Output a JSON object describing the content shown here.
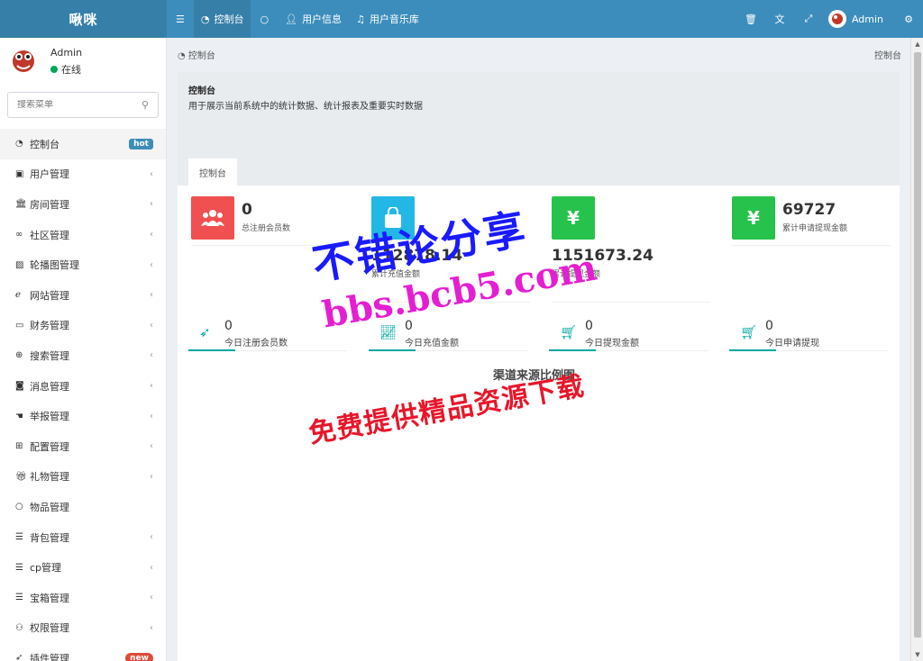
{
  "app": {
    "logo_text": "啾咪",
    "top_nav": [
      {
        "icon": "menu-toggle-icon",
        "label": ""
      },
      {
        "icon": "dashboard-icon",
        "label": "控制台"
      },
      {
        "icon": "circle-icon",
        "label": ""
      },
      {
        "icon": "user-icon",
        "label": "用户信息"
      },
      {
        "icon": "music-icon",
        "label": "用户音乐库"
      }
    ],
    "top_user_name": "Admin"
  },
  "sidebar": {
    "user_name": "Admin",
    "user_status": "在线",
    "search_placeholder": "搜索菜单",
    "items": [
      {
        "label": "控制台",
        "badge": "hot",
        "icon": "dashboard-icon"
      },
      {
        "label": "用户管理",
        "icon": "user-book-icon"
      },
      {
        "label": "房间管理",
        "icon": "bank-icon"
      },
      {
        "label": "社区管理",
        "icon": "bicycle-icon"
      },
      {
        "label": "轮播图管理",
        "icon": "image-icon"
      },
      {
        "label": "网站管理",
        "icon": "ie-icon"
      },
      {
        "label": "财务管理",
        "icon": "money-icon"
      },
      {
        "label": "搜索管理",
        "icon": "search-plus-icon"
      },
      {
        "label": "消息管理",
        "icon": "message-icon"
      },
      {
        "label": "举报管理",
        "icon": "hand-icon"
      },
      {
        "label": "配置管理",
        "icon": "sitemap-icon"
      },
      {
        "label": "礼物管理",
        "icon": "gift-icon"
      },
      {
        "label": "物品管理",
        "icon": "circle-icon"
      },
      {
        "label": "背包管理",
        "icon": "list-icon"
      },
      {
        "label": "cp管理",
        "icon": "list-icon"
      },
      {
        "label": "宝箱管理",
        "icon": "list-icon"
      },
      {
        "label": "权限管理",
        "icon": "group-icon"
      },
      {
        "label": "插件管理",
        "badge": "new",
        "icon": "rocket-icon"
      }
    ]
  },
  "breadcrumb": {
    "left": "控制台",
    "right": "控制台"
  },
  "panel": {
    "title": "控制台",
    "description": "用于展示当前系统中的统计数据、统计报表及重要实时数据",
    "tab": "控制台"
  },
  "stats": [
    {
      "value": "0",
      "label": "总注册会员数",
      "color": "#f05050",
      "icon": "users-icon"
    },
    {
      "value": "112878.14",
      "label": "累计充值金额",
      "color": "#23b7e5",
      "icon": "shopping-bag-icon"
    },
    {
      "value": "1151673.24",
      "label": "累计提现金额",
      "color": "#27c24c",
      "icon": "yen-icon"
    },
    {
      "value": "69727",
      "label": "累计申请提现金额",
      "color": "#27c24c",
      "icon": "yen-icon"
    }
  ],
  "today_stats": [
    {
      "value": "0",
      "label": "今日注册会员数",
      "icon": "rocket-icon"
    },
    {
      "value": "0",
      "label": "今日充值金额",
      "icon": "line-chart-icon"
    },
    {
      "value": "0",
      "label": "今日提现金额",
      "icon": "cart-icon"
    },
    {
      "value": "0",
      "label": "今日申请提现",
      "icon": "cart-icon"
    }
  ],
  "chart_title": "渠道来源比例图",
  "watermark": {
    "line1": "不错论分享",
    "line2": "bbs.bcb5.com",
    "line3": "免费提供精品资源下载"
  }
}
